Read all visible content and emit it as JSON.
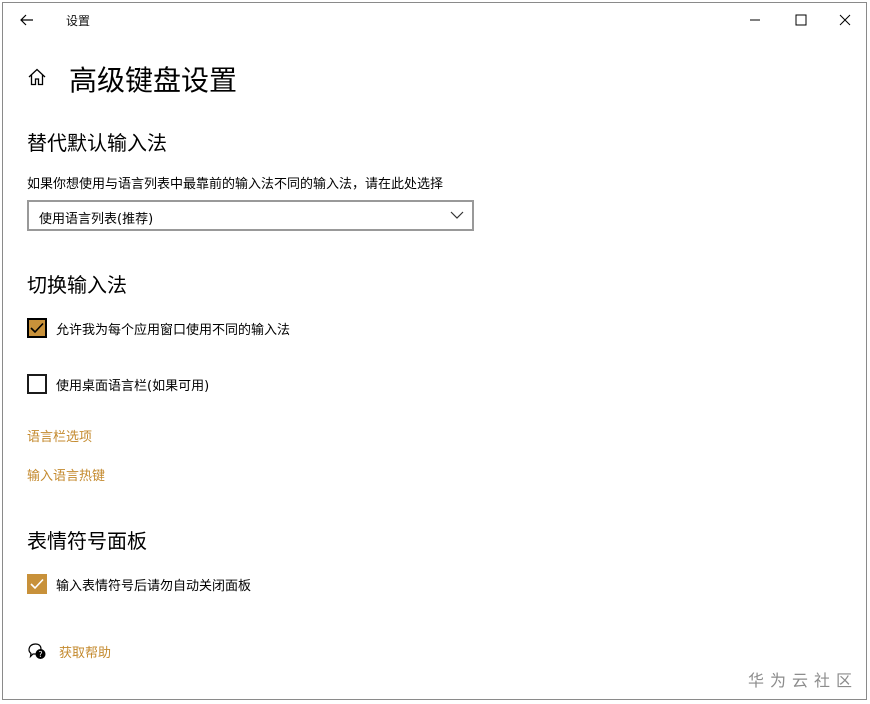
{
  "window": {
    "title": "设置"
  },
  "page": {
    "title": "高级键盘设置"
  },
  "section_override": {
    "title": "替代默认输入法",
    "description": "如果你想使用与语言列表中最靠前的输入法不同的输入法，请在此处选择",
    "dropdown_value": "使用语言列表(推荐)"
  },
  "section_switch": {
    "title": "切换输入法",
    "checkbox_per_app": {
      "label": "允许我为每个应用窗口使用不同的输入法",
      "checked": true
    },
    "checkbox_desktop_bar": {
      "label": "使用桌面语言栏(如果可用)",
      "checked": false
    },
    "link_langbar_options": "语言栏选项",
    "link_hotkeys": "输入语言热键"
  },
  "section_emoji": {
    "title": "表情符号面板",
    "checkbox_dont_close": {
      "label": "输入表情符号后请勿自动关闭面板",
      "checked": true
    }
  },
  "help": {
    "label": "获取帮助"
  },
  "watermark": "华为云社区",
  "colors": {
    "accent": "#c8913a",
    "link": "#c48a2e",
    "border": "#999999"
  },
  "icons": [
    "back-arrow-icon",
    "minimize-icon",
    "maximize-icon",
    "close-icon",
    "home-icon",
    "chevron-down-icon",
    "checkmark-icon",
    "help-chat-icon"
  ]
}
